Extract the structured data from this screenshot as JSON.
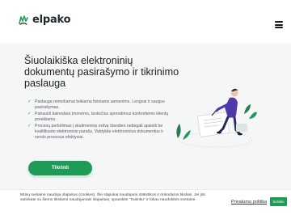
{
  "header": {
    "logo_text": "elpako",
    "menu_icon": "hamburger-menu-icon"
  },
  "hero": {
    "title": "Šiuolaikiška elektroninių dokumentų pasirašymo ir tikrinimo paslauga",
    "features": [
      "Paslauga nemokamai teikiama fiziniams asmenims. Lengvai ir saugus pasirašymas.",
      "Patraukli kainodara įmonėms, lanksčius sprendimus konkretiems klientų poreikiams.",
      "Procesų perkėlimas į skaitmeninę erdvę šiandien nebegali apsieiti be kvalifikuoto elektroninio parašo. Valdykite elektroninius dokumentus ir verslo procesus efektyviai."
    ],
    "cta_label": "Tikrinti"
  },
  "cookie_bar": {
    "text": "Mūsų svetainė naudoja slapukus (cookies). Šie slapukai naudojami statistikos ir rinkodaros tikslais. Jei jūs sutinkate su šiems tikslams naudojamais slapukais, spauskite \"Sutinku\" ir toliau naudokitės svetaine.",
    "policy_link": "Privatumo politika",
    "accept_label": "Sutinku"
  },
  "colors": {
    "brand_green": "#1f9b58",
    "hero_bg": "#f4f6f7",
    "illustration_purple": "#4b3aa8"
  }
}
